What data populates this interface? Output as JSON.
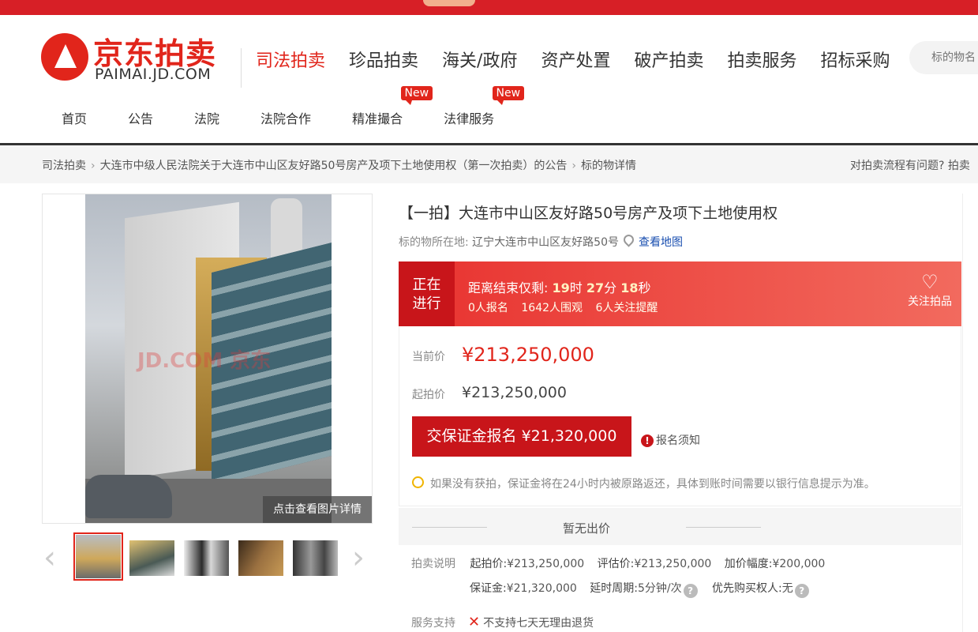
{
  "brand": {
    "name": "京东拍卖",
    "domain": "PAIMAI.JD.COM",
    "accent": "#e1251b"
  },
  "main_nav": [
    "司法拍卖",
    "珍品拍卖",
    "海关/政府",
    "资产处置",
    "破产拍卖",
    "拍卖服务",
    "招标采购"
  ],
  "search": {
    "placeholder": "标的物名"
  },
  "sub_nav": [
    {
      "label": "首页"
    },
    {
      "label": "公告"
    },
    {
      "label": "法院"
    },
    {
      "label": "法院合作"
    },
    {
      "label": "精准撮合",
      "badge": "New"
    },
    {
      "label": "法律服务",
      "badge": "New"
    }
  ],
  "breadcrumb": {
    "items": [
      "司法拍卖",
      "大连市中级人民法院关于大连市中山区友好路50号房产及项下土地使用权（第一次拍卖）的公告",
      "标的物详情"
    ],
    "separator": "›",
    "right_text": "对拍卖流程有问题? 拍卖"
  },
  "gallery": {
    "watermark": "JD.COM 京东",
    "detail_button": "点击查看图片详情",
    "prev": "‹",
    "next": "›"
  },
  "item": {
    "title": "【一拍】大连市中山区友好路50号房产及项下土地使用权",
    "location_label": "标的物所在地:",
    "location": "辽宁大连市中山区友好路50号",
    "map_link": "查看地图"
  },
  "status": {
    "badge_line1": "正在",
    "badge_line2": "进行",
    "countdown_label": "距离结束仅剩:",
    "hours": "19",
    "hours_unit": "时",
    "minutes": "27",
    "minutes_unit": "分",
    "seconds": "18",
    "seconds_unit": "秒",
    "signups": "0人报名",
    "watchers": "1642人围观",
    "reminders": "6人关注提醒",
    "follow_label": "关注拍品"
  },
  "prices": {
    "current_label": "当前价",
    "current": "¥213,250,000",
    "start_label": "起拍价",
    "start": "¥213,250,000",
    "deposit_button": "交保证金报名 ¥21,320,000",
    "notice": "报名须知",
    "tip": "如果没有获拍，保证金将在24小时内被原路返还，具体到账时间需要以银行信息提示为准。"
  },
  "bids": {
    "empty": "暂无出价"
  },
  "auction_info": {
    "label": "拍卖说明",
    "start_k": "起拍价:",
    "start_v": "¥213,250,000",
    "eval_k": "评估价:",
    "eval_v": "¥213,250,000",
    "inc_k": "加价幅度:",
    "inc_v": "¥200,000",
    "deposit_k": "保证金:",
    "deposit_v": "¥21,320,000",
    "delay_k": "延时周期:",
    "delay_v": "5分钟/次",
    "priority_k": "优先购买权人:",
    "priority_v": "无"
  },
  "service": {
    "label": "服务支持",
    "item": "不支持七天无理由退货"
  }
}
